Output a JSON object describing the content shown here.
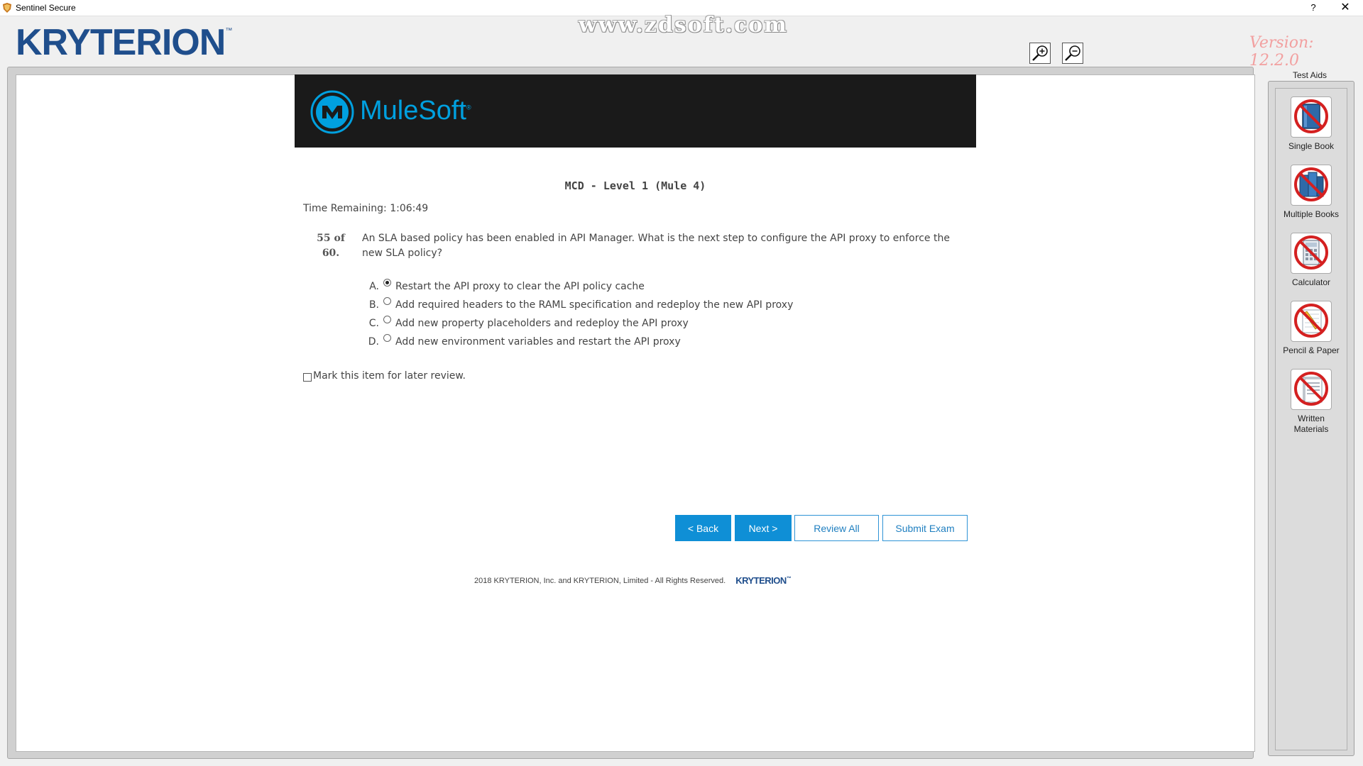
{
  "window": {
    "title": "Sentinel Secure",
    "help_label": "?",
    "close_label": "✕"
  },
  "header": {
    "brand": "KRYTERION",
    "brand_mark": "™",
    "watermark": "www.zdsoft.com",
    "version": "Version:  12.2.0",
    "zoom_in_icon": "zoom-in-magnifier",
    "zoom_out_icon": "zoom-out-magnifier"
  },
  "banner": {
    "logo_text": "MuleSoft",
    "logo_mark": "®",
    "background": "#1a1a1a",
    "accent": "#00a0df"
  },
  "exam": {
    "title": "MCD - Level 1 (Mule 4)",
    "time_remaining": "Time Remaining: 1:06:49",
    "question_number_line1": "55 of",
    "question_number_line2": "60.",
    "question_text": "An SLA based policy has been enabled in API Manager. What is the next step to configure the API proxy to enforce the new SLA policy?",
    "options": [
      {
        "letter": "A.",
        "text": "Restart the API proxy to clear the API policy cache",
        "selected": true
      },
      {
        "letter": "B.",
        "text": "Add required headers to the RAML specification and redeploy the new API proxy",
        "selected": false
      },
      {
        "letter": "C.",
        "text": "Add new property placeholders and redeploy the API proxy",
        "selected": false
      },
      {
        "letter": "D.",
        "text": "Add new environment variables and restart the API proxy",
        "selected": false
      }
    ],
    "mark_review_label": "Mark this item for later review.",
    "mark_review_checked": false
  },
  "buttons": {
    "back": "< Back",
    "next": "Next >",
    "review_all": "Review All",
    "submit": "Submit Exam",
    "primary_color": "#0f8fd6"
  },
  "footer": {
    "copyright": "2018   KRYTERION, Inc. and KRYTERION, Limited - All Rights Reserved.",
    "logo": "KRYTERION",
    "logo_mark": "™"
  },
  "test_aids": {
    "title": "Test Aids",
    "items": [
      {
        "label": "Single Book",
        "icon": "single-book-icon"
      },
      {
        "label": "Multiple Books",
        "icon": "multiple-books-icon"
      },
      {
        "label": "Calculator",
        "icon": "calculator-icon"
      },
      {
        "label": "Pencil & Paper",
        "icon": "pencil-paper-icon"
      },
      {
        "label": "Written Materials",
        "icon": "written-materials-icon"
      }
    ]
  }
}
